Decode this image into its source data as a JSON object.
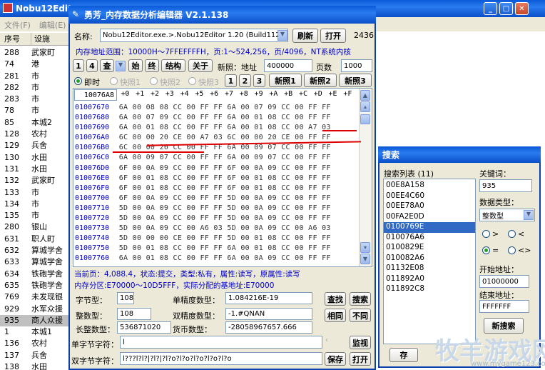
{
  "bg_window": {
    "title": "Nobu12Edito",
    "menu": [
      "文件(F)",
      "编辑(E)"
    ],
    "col_no": "序号",
    "col_name": "设施",
    "rows": [
      [
        "288",
        "武家町"
      ],
      [
        "74",
        "港"
      ],
      [
        "281",
        "市"
      ],
      [
        "282",
        "市"
      ],
      [
        "283",
        "市"
      ],
      [
        "78",
        "市"
      ],
      [
        "85",
        "本城2"
      ],
      [
        "128",
        "农村"
      ],
      [
        "129",
        "兵舍"
      ],
      [
        "130",
        "水田"
      ],
      [
        "131",
        "水田"
      ],
      [
        "132",
        "武家町"
      ],
      [
        "133",
        "市"
      ],
      [
        "134",
        "市"
      ],
      [
        "135",
        "市"
      ],
      [
        "280",
        "银山"
      ],
      [
        "631",
        "职人町"
      ],
      [
        "632",
        "算城学舍"
      ],
      [
        "633",
        "算城学舍"
      ],
      [
        "634",
        "铁砲学舍"
      ],
      [
        "635",
        "铁砲学舍"
      ],
      [
        "769",
        "未发现银"
      ],
      [
        "929",
        "水军众援"
      ],
      [
        "935",
        "商人众援"
      ],
      [
        "1",
        "本城1"
      ],
      [
        "136",
        "农村"
      ],
      [
        "137",
        "兵舍"
      ],
      [
        "138",
        "水田"
      ]
    ],
    "selected_index": 23
  },
  "main": {
    "title": "勇芳_内存数据分析编辑器 V2.1.138",
    "name_label": "名称:",
    "process": "Nobu12Editor.exe.>.Nobu12Editor 1.20 (Build1129)",
    "refresh": "刷新",
    "open": "打开",
    "pid": "2436",
    "range_text": "内存地址范围：10000H～7FFEFFFFH，页:1～524,256，页/4096，NT系统内核",
    "nav": [
      "1",
      "4",
      "查",
      "始",
      "终",
      "结构",
      "关于"
    ],
    "snapshot_label": "新照：地址",
    "addr_value": "400000",
    "pages_label": "页数",
    "pages_value": "1000",
    "realtime": "即时",
    "snaps": [
      "快照1",
      "快照2",
      "快照3"
    ],
    "snap_nums": [
      "1",
      "2",
      "3"
    ],
    "new_snaps": [
      "新照1",
      "新照2",
      "新照3"
    ],
    "hex_addr": "10076A8",
    "hex_cols": [
      "+0",
      "+1",
      "+2",
      "+3",
      "+4",
      "+5",
      "+6",
      "+7",
      "+8",
      "+9",
      "+A",
      "+B",
      "+C",
      "+D",
      "+E",
      "+F"
    ],
    "hex_rows": [
      [
        "01007670",
        "6A 00 08 08 CC 00 FF FF 6A 00 07 09 CC 00 FF FF"
      ],
      [
        "01007680",
        "6A 00 07 09 CC 00 FF FF 6A 00 01 08 CC 00 FF FF"
      ],
      [
        "01007690",
        "6A 00 01 08 CC 00 FF FF 6A 00 01 08 CC 00 A7 03"
      ],
      [
        "010076A0",
        "6C 00 00 20 CE 00 A7 03 6C 00 00 20 CE 00 FF FF"
      ],
      [
        "010076B0",
        "6C 00 00 20 CC 00 FF FF 6A 00 09 07 CC 00 FF FF"
      ],
      [
        "010076C0",
        "6A 00 09 07 CC 00 FF FF 6A 00 09 07 CC 00 FF FF"
      ],
      [
        "010076D0",
        "6F 00 0A 09 CC 00 FF FF 6F 00 0A 09 CC 00 FF FF"
      ],
      [
        "010076E0",
        "6F 00 01 08 CC 00 FF FF 6F 00 01 08 CC 00 FF FF"
      ],
      [
        "010076F0",
        "6F 00 01 08 CC 00 FF FF 6F 00 01 08 CC 00 FF FF"
      ],
      [
        "01007700",
        "6F 00 0A 09 CC 00 FF FF 5D 00 0A 09 CC 00 FF FF"
      ],
      [
        "01007710",
        "5D 00 0A 09 CC 00 FF FF 5D 00 0A 09 CC 00 FF FF"
      ],
      [
        "01007720",
        "5D 00 0A 09 CC 00 FF FF 5D 00 0A 09 CC 00 FF FF"
      ],
      [
        "01007730",
        "5D 00 0A 09 CC 00 A6 03 5D 00 0A 09 CC 00 A6 03"
      ],
      [
        "01007740",
        "5D 00 00 00 CE 00 FF FF 5D 00 01 08 CC 00 FF FF"
      ],
      [
        "01007750",
        "5D 00 01 08 CC 00 FF FF 6A 00 01 08 CC 00 FF FF"
      ],
      [
        "01007760",
        "6A 00 01 08 CC 00 FF FF 6A 00 0A 09 CC 00 FF FF"
      ]
    ],
    "status1": "当前页：4,088.4，状态:提交，类型:私有，属性:读写，原属性:读写",
    "status2": "内存分区:E70000～10D5FFF，实际分配的基地址:E70000",
    "byte_label": "字节型：",
    "byte_val": "108",
    "single_label": "单精度数型：",
    "single_val": "1.084216E-19",
    "int_label": "整数型：",
    "int_val": "108",
    "double_label": "双精度数型：",
    "double_val": "-1.#QNAN",
    "long_label": "长整数型：",
    "long_val": "536871020",
    "currency_label": "货币数型：",
    "currency_val": "-28058967657.666",
    "sbstr_label": "单字节字符：",
    "sbstr_val": "l",
    "dbstr_label": "双字节字符：",
    "dbstr_val": "l???l?l?|?l?|?l?o?l?o?l?o?l?o?l?o",
    "btn_find": "查找",
    "btn_search": "搜索",
    "btn_same": "相同",
    "btn_diff": "不同",
    "btn_watch": "监视",
    "btn_save": "保存",
    "btn_open": "打开"
  },
  "search": {
    "title": "搜索",
    "list_label": "搜索列表 (11)",
    "items": [
      "00E8A158",
      "00EE4C60",
      "00EE78A0",
      "00FA2E0D",
      "0100769E",
      "010076A6",
      "0100829E",
      "010082A6",
      "01132E08",
      "011892A0",
      "011892C8"
    ],
    "selected": 4,
    "keyword_label": "关键词：",
    "keyword": "935",
    "dtype_label": "数据类型：",
    "dtype": "整数型",
    "ops": [
      ">",
      "<",
      "=",
      "<>"
    ],
    "start_label": "开始地址：",
    "start": "01000000",
    "end_label": "结束地址：",
    "end": "FFFFFFF",
    "new_search": "新搜索",
    "save": "存"
  },
  "watermark": {
    "text": "牧羊游戏网",
    "url": "www.mygame123.com"
  }
}
